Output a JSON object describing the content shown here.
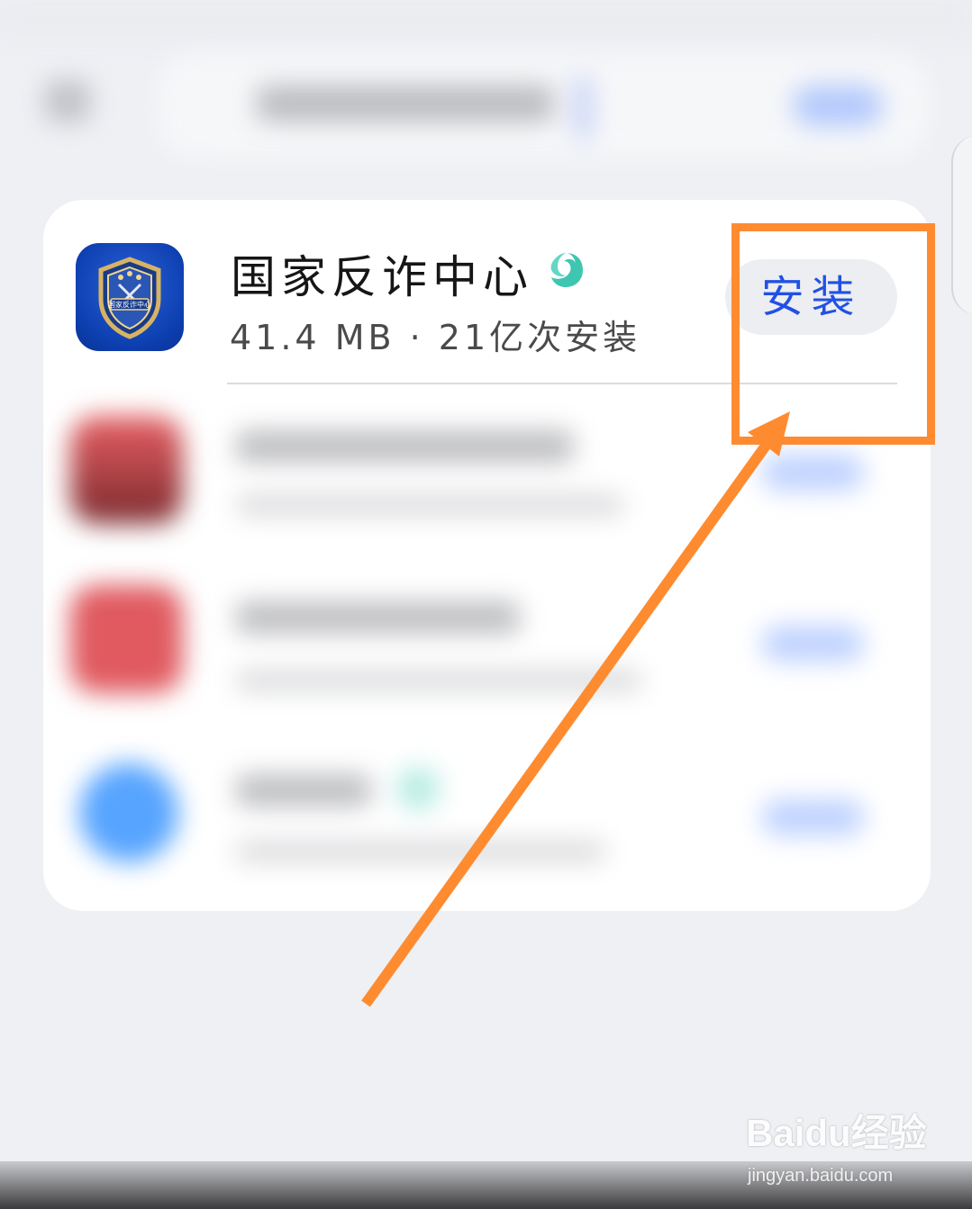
{
  "app": {
    "name": "国家反诈中心",
    "meta": "41.4 MB  ·  21亿次安装",
    "install_label": "安装",
    "icon_label": "国家反诈中心"
  },
  "watermark": {
    "logo": "Baidu经验",
    "url": "jingyan.baidu.com"
  },
  "colors": {
    "highlight": "#ff8b30",
    "install_text": "#2250e6",
    "verify_badge": "#3ec6b0"
  }
}
